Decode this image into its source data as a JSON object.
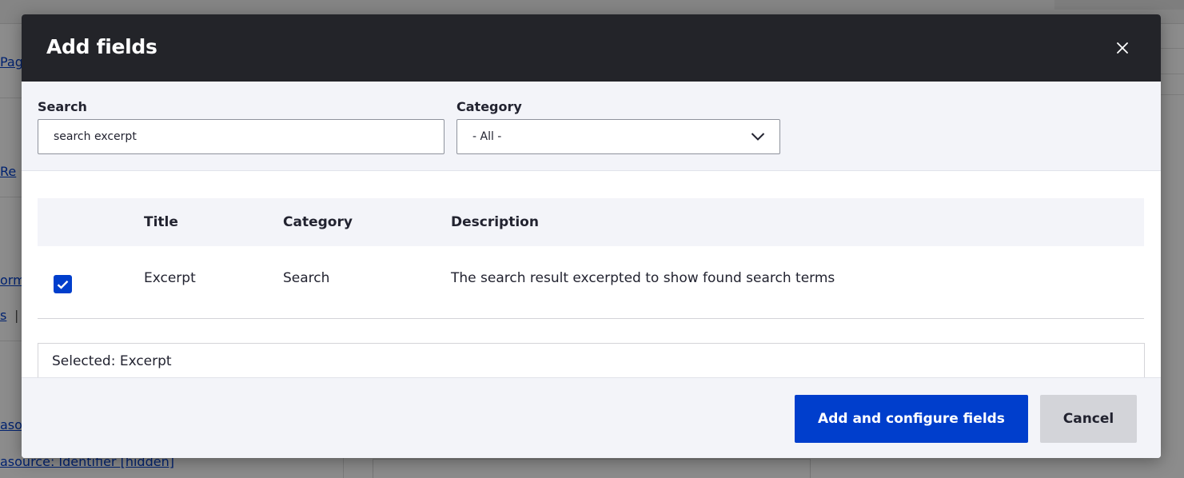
{
  "background": {
    "links": [
      "Pag",
      "Re",
      "orm",
      "s",
      "asou",
      "asource: Identifier [hidden]"
    ],
    "separator": "|"
  },
  "dialog": {
    "title": "Add fields",
    "close_icon": "close-icon"
  },
  "filters": {
    "search_label": "Search",
    "search_value": "search excerpt",
    "category_label": "Category",
    "category_selected": "- All -"
  },
  "table": {
    "headers": {
      "title": "Title",
      "category": "Category",
      "description": "Description"
    },
    "rows": [
      {
        "checked": true,
        "title": "Excerpt",
        "category": "Search",
        "description": "The search result excerpted to show found search terms"
      }
    ]
  },
  "selected": {
    "text": "Selected: Excerpt"
  },
  "footer": {
    "primary_label": "Add and configure fields",
    "cancel_label": "Cancel"
  },
  "colors": {
    "header_bg": "#232429",
    "accent": "#003ecc",
    "panel_bg": "#f3f4f9",
    "cancel_bg": "#d3d4d9"
  }
}
